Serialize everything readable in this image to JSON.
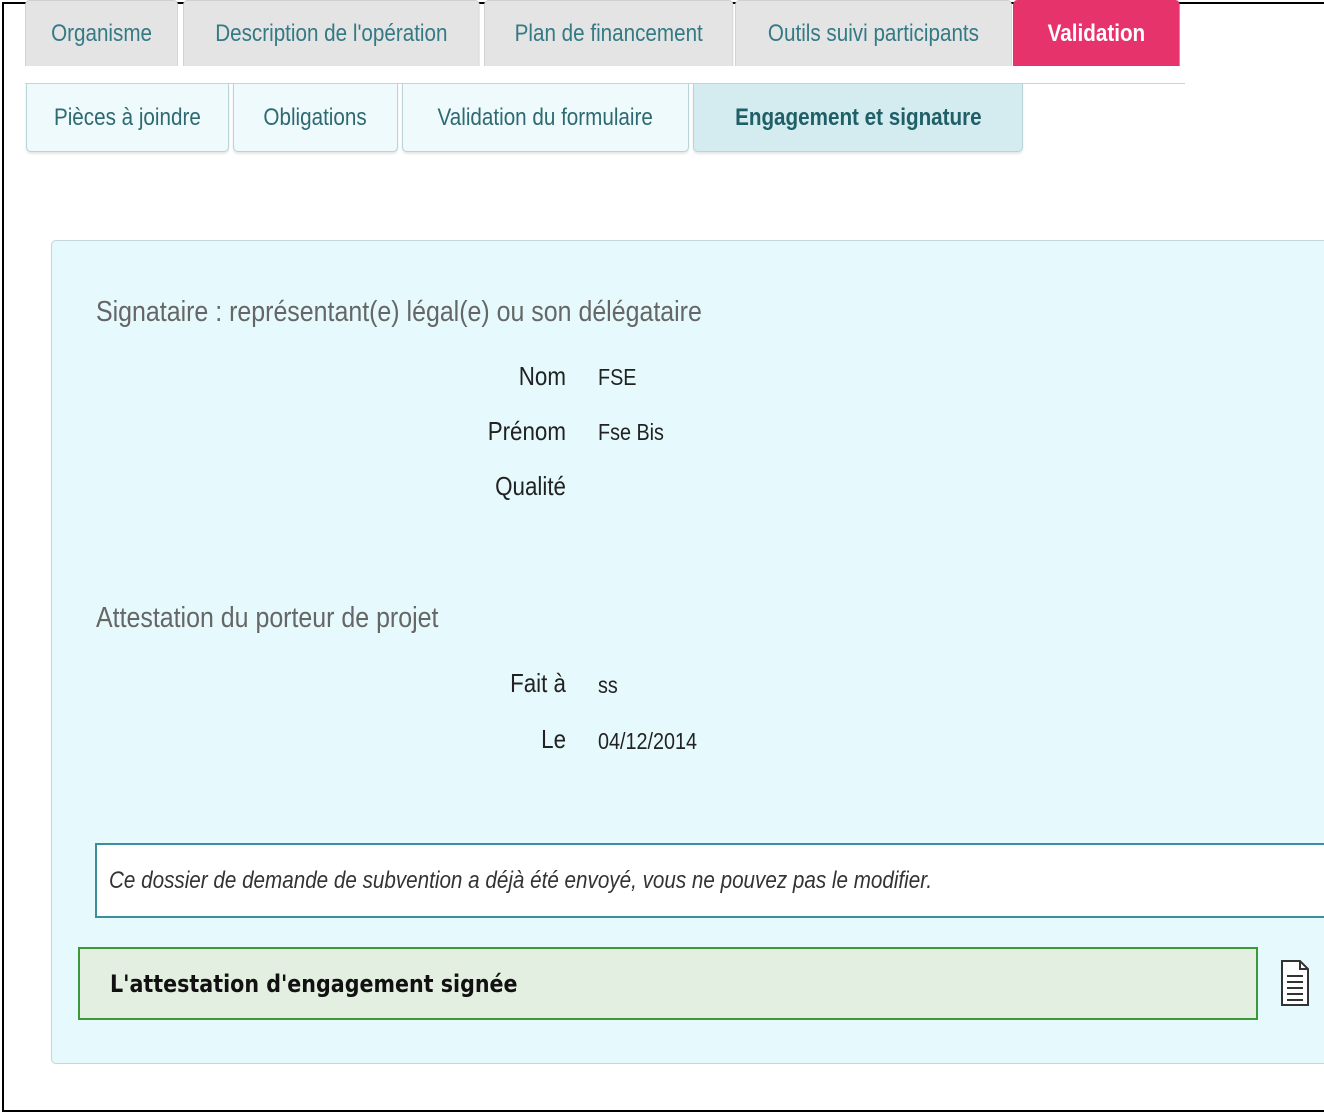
{
  "main_tabs": [
    {
      "label": "Organisme"
    },
    {
      "label": "Description de l'opération"
    },
    {
      "label": "Plan de financement"
    },
    {
      "label": "Outils suivi participants"
    },
    {
      "label": "Validation"
    }
  ],
  "sub_tabs": [
    {
      "label": "Pièces à joindre"
    },
    {
      "label": "Obligations"
    },
    {
      "label": "Validation du formulaire"
    },
    {
      "label": "Engagement et signature"
    }
  ],
  "signataire": {
    "title": "Signataire : représentant(e) légal(e) ou son délégataire",
    "nom_label": "Nom",
    "nom_value": "FSE",
    "prenom_label": "Prénom",
    "prenom_value": "Fse Bis",
    "qualite_label": "Qualité",
    "qualite_value": ""
  },
  "attestation": {
    "title": "Attestation du porteur de projet",
    "fait_label": "Fait à",
    "fait_value": "ss",
    "le_label": "Le",
    "le_value": "04/12/2014"
  },
  "notice": "Ce dossier de demande de subvention a déjà été envoyé, vous ne pouvez pas le modifier.",
  "signed_doc": {
    "label": "L'attestation d'engagement signée",
    "icon": "document-icon"
  },
  "colors": {
    "active_tab": "#e7336b",
    "panel_bg": "#e6fafd",
    "notice_border": "#3b8f9b",
    "signed_border": "#3a9a3a",
    "signed_bg": "#e3efe1"
  }
}
